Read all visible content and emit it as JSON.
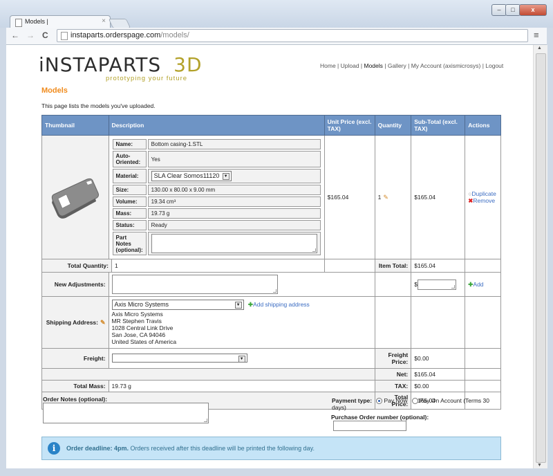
{
  "browser": {
    "tab_title": "Models |",
    "tab_close": "×",
    "url_host": "instaparts.orderspage.com",
    "url_path": "/models/",
    "controls": {
      "minimize": "–",
      "maximize": "□",
      "close": "x"
    },
    "nav": {
      "back": "←",
      "forward": "→",
      "reload": "C",
      "menu": "≡"
    }
  },
  "site": {
    "logo_main": "iNSTAPARTS",
    "logo_3d": "3D",
    "tagline": "prototyping your future",
    "nav": {
      "home": "Home",
      "upload": "Upload",
      "models": "Models",
      "gallery": "Gallery",
      "account": "My Account (axismicrosys)",
      "logout": "Logout",
      "sep": " | "
    }
  },
  "page": {
    "title": "Models",
    "intro": "This page lists the models you've uploaded."
  },
  "table": {
    "headers": {
      "thumbnail": "Thumbnail",
      "description": "Description",
      "unit_price": "Unit Price (excl. TAX)",
      "quantity": "Quantity",
      "subtotal": "Sub-Total (excl. TAX)",
      "actions": "Actions"
    },
    "model": {
      "labels": {
        "name": "Name:",
        "auto_oriented": "Auto-Oriented:",
        "material": "Material:",
        "size": "Size:",
        "volume": "Volume:",
        "mass": "Mass:",
        "status": "Status:",
        "part_notes": "Part Notes (optional):"
      },
      "name": "Bottom casing-1.STL",
      "auto_oriented": "Yes",
      "material": "SLA Clear Somos11120",
      "size": "130.00 x 80.00 x 9.00 mm",
      "volume": "19.34 cm³",
      "mass": "19.73 g",
      "status": "Ready",
      "unit_price": "$165.04",
      "quantity": "1",
      "subtotal": "$165.04",
      "duplicate": "Duplicate",
      "remove": "Remove"
    },
    "summary": {
      "total_quantity_label": "Total Quantity:",
      "total_quantity": "1",
      "item_total_label": "Item Total:",
      "item_total": "$165.04",
      "new_adjustments_label": "New Adjustments:",
      "currency_symbol": "$",
      "add": "Add",
      "shipping_label": "Shipping Address:",
      "shipping_select": "Axis Micro Systems",
      "add_shipping": "Add shipping address",
      "address_lines": [
        "Axis Micro Systems",
        "MR Stephen Travis",
        "1028 Central Link Drive",
        "San Jose, CA 94046",
        "United States of America"
      ],
      "freight_label": "Freight:",
      "freight_price_label": "Freight Price:",
      "freight_price": "$0.00",
      "net_label": "Net:",
      "net": "$165.04",
      "total_mass_label": "Total Mass:",
      "total_mass": "19.73 g",
      "tax_label": "TAX:",
      "tax": "$0.00",
      "total_price_label": "Total Price:",
      "total_price": "$165.04"
    }
  },
  "order": {
    "notes_label": "Order Notes (optional):",
    "payment_type_label": "Payment type:",
    "pay_now": "Pay Now",
    "pay_on_account": "Pay On Account (Terms 30 days)",
    "po_label": "Purchase Order number (optional):"
  },
  "deadline": {
    "bold": "Order deadline: 4pm.",
    "text": " Orders received after this deadline will be printed the following day."
  }
}
